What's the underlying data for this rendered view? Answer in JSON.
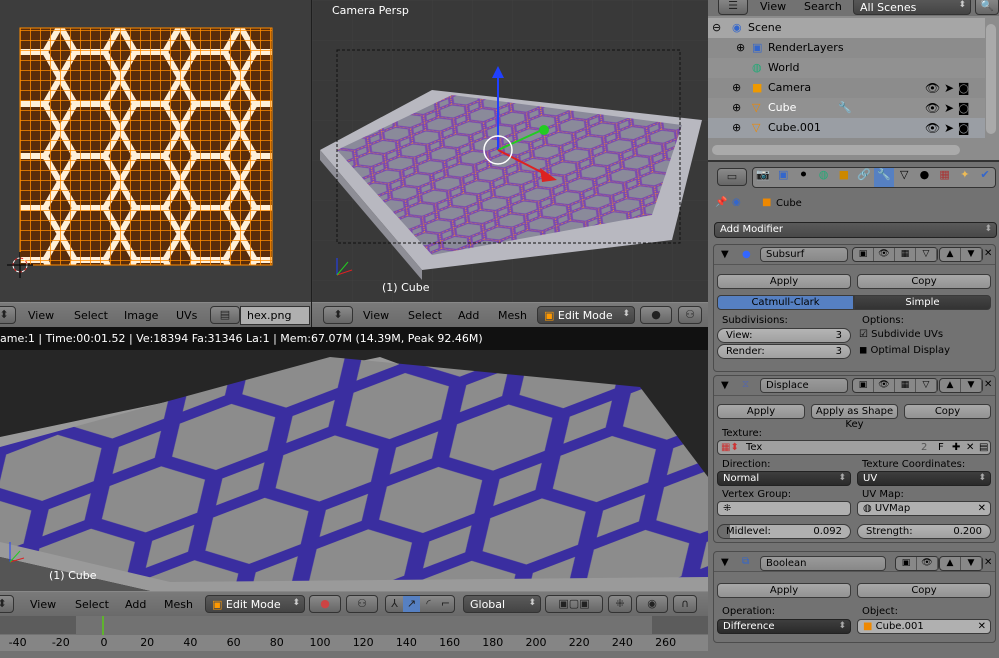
{
  "uv_editor": {
    "header": {
      "menus": [
        "View",
        "Select",
        "Image",
        "UVs"
      ],
      "image_name": "hex.png"
    }
  },
  "viewport_top": {
    "view_label": "Camera Persp",
    "object_label": "(1) Cube",
    "header": {
      "menus": [
        "View",
        "Select",
        "Add",
        "Mesh"
      ],
      "mode": "Edit Mode"
    }
  },
  "render_view": {
    "info": "ame:1 | Time:00:01.52 | Ve:18394 Fa:31346 La:1 | Mem:67.07M (14.39M, Peak 92.46M)",
    "object_label": "(1) Cube",
    "header": {
      "menus": [
        "View",
        "Select",
        "Add",
        "Mesh"
      ],
      "mode": "Edit Mode",
      "orientation": "Global"
    }
  },
  "timeline": {
    "ticks": [
      "-40",
      "-20",
      "0",
      "20",
      "40",
      "60",
      "80",
      "100",
      "120",
      "140",
      "160",
      "180",
      "200",
      "220",
      "240",
      "260"
    ],
    "current_frame": 0,
    "accent": "#5fb32e"
  },
  "outliner": {
    "menus": [
      "View",
      "Search"
    ],
    "scope": "All Scenes",
    "items": [
      {
        "label": "Scene"
      },
      {
        "label": "RenderLayers"
      },
      {
        "label": "World"
      },
      {
        "label": "Camera"
      },
      {
        "label": "Cube"
      },
      {
        "label": "Cube.001"
      }
    ]
  },
  "properties": {
    "context_object": "Cube",
    "add_modifier": "Add Modifier",
    "subsurf": {
      "name": "Subsurf",
      "apply": "Apply",
      "copy": "Copy",
      "tabs": [
        "Catmull-Clark",
        "Simple"
      ],
      "active_tab": "Catmull-Clark",
      "subdivisions_label": "Subdivisions:",
      "options_label": "Options:",
      "view_label": "View:",
      "view_value": "3",
      "render_label": "Render:",
      "render_value": "3",
      "subdivide_uvs": "Subdivide UVs",
      "subdivide_uvs_checked": true,
      "optimal_display": "Optimal Display",
      "optimal_display_checked": false
    },
    "displace": {
      "name": "Displace",
      "apply": "Apply",
      "apply_shape": "Apply as Shape Key",
      "copy": "Copy",
      "texture_label": "Texture:",
      "texture": "Tex",
      "texture_users": "2",
      "fake_user": "F",
      "direction_label": "Direction:",
      "direction": "Normal",
      "texcoords_label": "Texture Coordinates:",
      "texcoords": "UV",
      "vgroup_label": "Vertex Group:",
      "uvmap_label": "UV Map:",
      "uvmap": "UVMap",
      "midlevel_label": "Midlevel:",
      "midlevel": "0.092",
      "strength_label": "Strength:",
      "strength": "0.200"
    },
    "boolean": {
      "name": "Boolean",
      "apply": "Apply",
      "copy": "Copy",
      "operation_label": "Operation:",
      "operation": "Difference",
      "object_label": "Object:",
      "object": "Cube.001"
    }
  },
  "colors": {
    "selection": "#5680c2",
    "wire": "#ff8c00",
    "mesh": "#3a2ea0"
  }
}
